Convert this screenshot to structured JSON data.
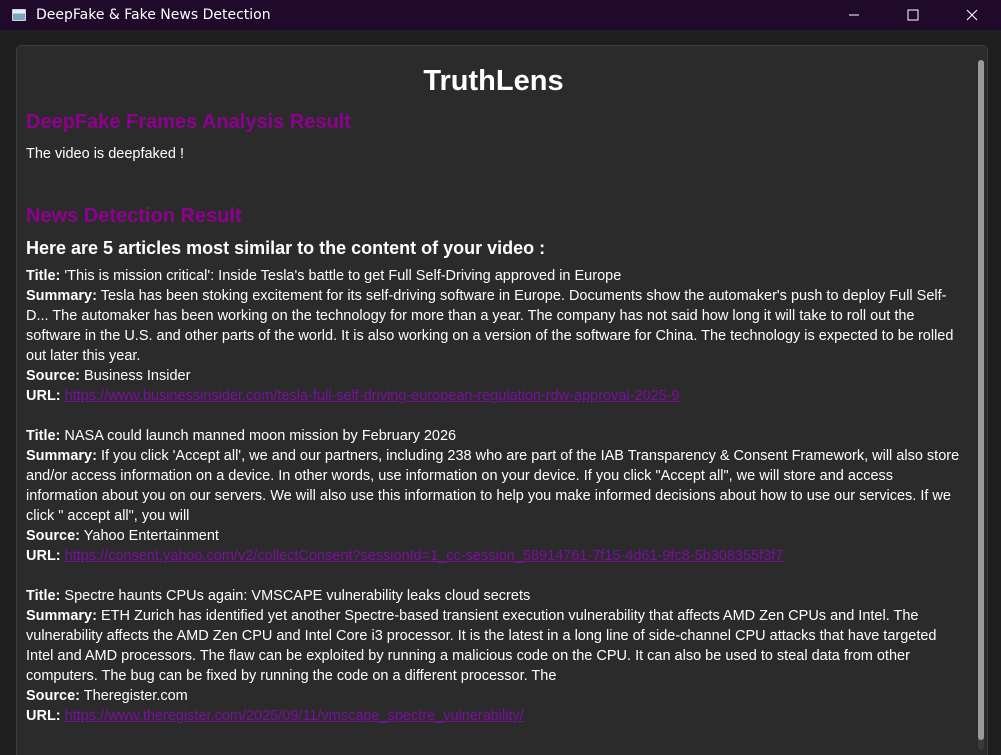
{
  "window": {
    "title": "DeepFake & Fake News Detection"
  },
  "app": {
    "title": "TruthLens"
  },
  "deepfake": {
    "heading": "DeepFake Frames Analysis Result",
    "result": "The video is deepfaked !"
  },
  "news": {
    "heading": "News Detection Result",
    "intro": "Here are 5 articles most similar to the content of your video :",
    "labels": {
      "title": "Title:",
      "summary": "Summary:",
      "source": "Source:",
      "url": "URL:"
    },
    "articles": [
      {
        "title": "'This is mission critical': Inside Tesla's battle to get Full Self-Driving approved in Europe",
        "summary": "Tesla has been stoking excitement for its self-driving software in Europe. Documents show the automaker's push to deploy Full Self-D... The automaker has been working on the technology for more than a year. The company has not said how long it will take to roll out the software in the U.S. and other parts of the world. It is also working on a version of the software for China. The technology is expected to be rolled out later this year.",
        "source": "Business Insider",
        "url": "https://www.businessinsider.com/tesla-full-self-driving-european-regulation-rdw-approval-2025-9"
      },
      {
        "title": "NASA could launch manned moon mission by February 2026",
        "summary": "If you click 'Accept all', we and our partners, including 238 who are part of the IAB Transparency & Consent Framework, will also store and/or access information on a device. In other words, use information on your device. If you click \"Accept all\", we will store and access information about you on our servers. We will also use this information to help you make informed decisions about how to use our services. If we click \" accept all\", you will",
        "source": "Yahoo Entertainment",
        "url": "https://consent.yahoo.com/v2/collectConsent?sessionId=1_cc-session_58914761-7f15-4d61-9fc8-5b308355f3f7"
      },
      {
        "title": "Spectre haunts CPUs again: VMSCAPE vulnerability leaks cloud secrets",
        "summary": "ETH Zurich has identified yet another Spectre-based transient execution vulnerability that affects AMD Zen CPUs and Intel. The vulnerability affects the AMD Zen CPU and Intel Core i3 processor. It is the latest in a long line of side-channel CPU attacks that have targeted Intel and AMD processors. The flaw can be exploited by running a malicious code on the CPU. It can also be used to steal data from other computers. The bug can be fixed by running the code on a different processor. The",
        "source": "Theregister.com",
        "url": "https://www.theregister.com/2025/09/11/vmscape_spectre_vulnerability/"
      }
    ]
  },
  "colors": {
    "heading_accent": "#8e008e",
    "link": "#7b0f9e",
    "titlebar_bg": "#200a2b",
    "panel_bg": "#2b2b2b"
  },
  "icons": {
    "app": "app-window-icon",
    "minimize": "minimize-icon",
    "maximize": "maximize-icon",
    "close": "close-icon"
  }
}
